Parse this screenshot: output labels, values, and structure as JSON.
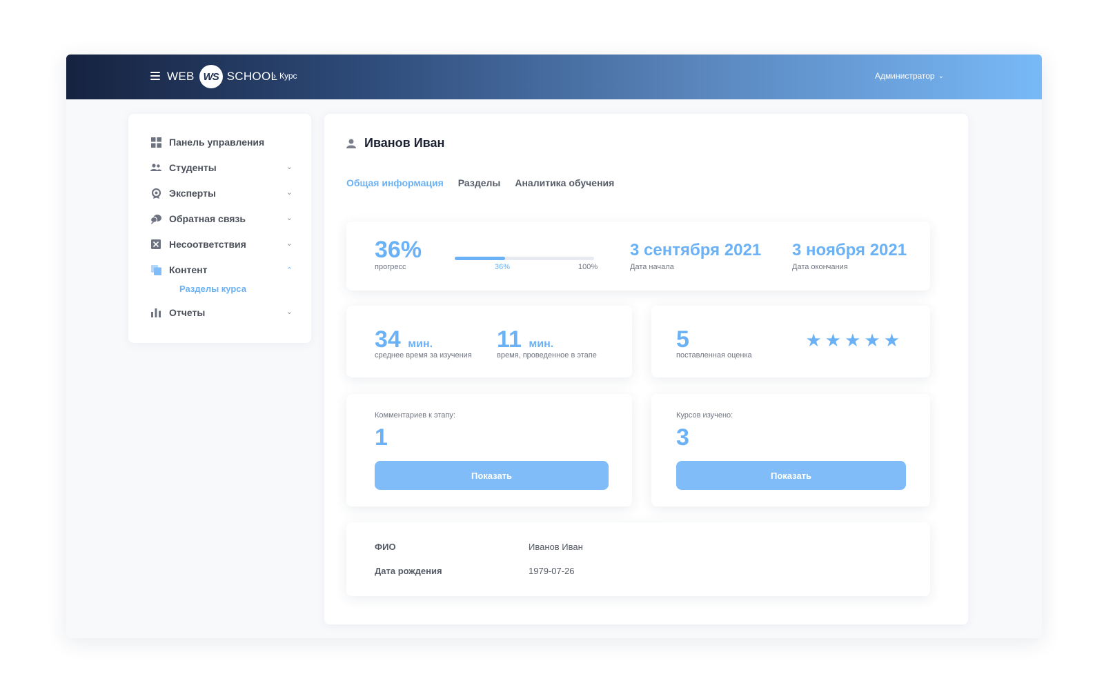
{
  "header": {
    "logo_left": "WEB",
    "logo_mark": "WS",
    "logo_right": "SCHOOL",
    "breadcrumb_sep": "›",
    "breadcrumb": "Курс",
    "user": "Администратор",
    "user_chevron": "⌄"
  },
  "sidebar": {
    "items": [
      {
        "label": "Панель управления",
        "icon": "dashboard-icon",
        "has_arrow": false
      },
      {
        "label": "Студенты",
        "icon": "users-icon",
        "has_arrow": true
      },
      {
        "label": "Эксперты",
        "icon": "expert-icon",
        "has_arrow": true
      },
      {
        "label": "Обратная связь",
        "icon": "chat-icon",
        "has_arrow": true
      },
      {
        "label": "Несоответствия",
        "icon": "x-box-icon",
        "has_arrow": true
      },
      {
        "label": "Контент",
        "icon": "content-icon",
        "has_arrow": true,
        "expanded": true
      },
      {
        "label": "Отчеты",
        "icon": "bar-chart-icon",
        "has_arrow": true
      }
    ],
    "sub_item": "Разделы курса",
    "arrow_down": "⌄",
    "arrow_up": "⌃"
  },
  "main": {
    "person_name": "Иванов Иван",
    "tabs": [
      "Общая информация",
      "Разделы",
      "Аналитика обучения"
    ],
    "progress": {
      "value": "36%",
      "label": "прогресс",
      "fraction": 0.36,
      "bar_label": "36%",
      "bar_max": "100%"
    },
    "start": {
      "value": "3 сентября 2021",
      "label": "Дата начала"
    },
    "end": {
      "value": "3 ноября 2021",
      "label": "Дата окончания"
    },
    "avg_time": {
      "value": "34",
      "unit": "мин.",
      "label": "среднее время за изучения"
    },
    "stage_time": {
      "value": "11",
      "unit": "мин.",
      "label": "время, проведенное в этапе"
    },
    "rating": {
      "value": "5",
      "label": "поставленная оценка",
      "stars": 5,
      "star_glyph": "★"
    },
    "comments": {
      "label": "Комментариев к этапу:",
      "value": "1",
      "button": "Показать"
    },
    "courses": {
      "label": "Курсов изучено:",
      "value": "3",
      "button": "Показать"
    },
    "info": {
      "fio_label": "ФИО",
      "fio_value": "Иванов Иван",
      "birth_label": "Дата рождения",
      "birth_value": "1979-07-26"
    }
  },
  "colors": {
    "accent": "#6ab1f5",
    "button": "#7fbcf8",
    "header_start": "#16223f",
    "header_end": "#78b9f7"
  }
}
